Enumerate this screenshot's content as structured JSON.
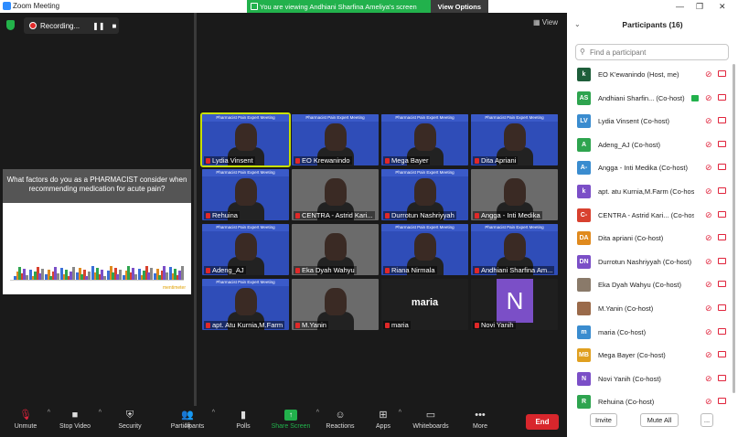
{
  "window": {
    "title": "Zoom Meeting"
  },
  "share_banner": {
    "text": "You are viewing Andhiani Sharfina Ameliya's screen",
    "view_options": "View Options"
  },
  "recording": {
    "label": "Recording..."
  },
  "view_button": "View",
  "shared_slide": {
    "question": "What factors do you as a PHARMACIST consider when recommending medication for acute pain?",
    "footer_logo": "mentimeter"
  },
  "video_tiles": [
    {
      "name": "Lydia Vinsent",
      "style": "blue",
      "banner": "Pharmacist Pain Expert Meeting",
      "active": true
    },
    {
      "name": "EO Krewanindo",
      "style": "blue",
      "banner": "Pharmacist Pain Expert Meeting"
    },
    {
      "name": "Mega Bayer",
      "style": "blue",
      "banner": "Pharmacist Pain Expert Meeting"
    },
    {
      "name": "Dita Apriani",
      "style": "blue",
      "banner": "Pharmacist Pain Expert Meeting"
    },
    {
      "name": "Rehuina",
      "style": "blue",
      "banner": "Pharmacist Pain Expert Meeting"
    },
    {
      "name": "CENTRA - Astrid Kari...",
      "style": "photo"
    },
    {
      "name": "Durrotun Nashriyyah",
      "style": "blue",
      "banner": "Pharmacist Pain Expert Meeting"
    },
    {
      "name": "Angga - Inti Medika",
      "style": "photo"
    },
    {
      "name": "Adeng_AJ",
      "style": "blue",
      "banner": "Pharmacist Pain Expert Meeting"
    },
    {
      "name": "Eka Dyah Wahyu",
      "style": "photo"
    },
    {
      "name": "Riana Nirmala",
      "style": "blue",
      "banner": "Pharmacist Pain Expert Meeting"
    },
    {
      "name": "Andhiani Sharfina Am...",
      "style": "blue",
      "banner": "Pharmacist Pain Expert Meeting"
    },
    {
      "name": "apt. Atu Kurnia,M.Farm",
      "style": "blue",
      "banner": "Pharmacist Pain Expert Meeting"
    },
    {
      "name": "M.Yanin",
      "style": "photo"
    },
    {
      "name": "maria",
      "style": "dark",
      "big": "maria"
    },
    {
      "name": "Novi Yanih",
      "style": "dark",
      "letter": "N"
    }
  ],
  "toolbar": {
    "unmute": "Unmute",
    "stop_video": "Stop Video",
    "security": "Security",
    "participants": "Participants",
    "participants_count": "16",
    "polls": "Polls",
    "share_screen": "Share Screen",
    "reactions": "Reactions",
    "apps": "Apps",
    "whiteboards": "Whiteboards",
    "more": "More",
    "end": "End"
  },
  "panel": {
    "title": "Participants (16)",
    "search_placeholder": "Find a participant",
    "participants": [
      {
        "initials": "k",
        "color": "#1e5e3a",
        "name": "EO K'ewanindo (Host, me)"
      },
      {
        "initials": "AS",
        "color": "#2ea44f",
        "name": "Andhiani Sharfin... (Co-host)",
        "sharing": true
      },
      {
        "initials": "LV",
        "color": "#3a8ccf",
        "name": "Lydia Vinsent (Co-host)"
      },
      {
        "initials": "A",
        "color": "#2ea44f",
        "name": "Adeng_AJ (Co-host)"
      },
      {
        "initials": "A-",
        "color": "#3a8ccf",
        "name": "Angga - Inti Medika (Co-host)"
      },
      {
        "initials": "k",
        "color": "#7b4fc7",
        "name": "apt. atu Kurnia,M.Farm (Co-host)"
      },
      {
        "initials": "C-",
        "color": "#d8412f",
        "name": "CENTRA - Astrid Kari... (Co-host)"
      },
      {
        "initials": "DA",
        "color": "#e08a1e",
        "name": "Dita apriani (Co-host)"
      },
      {
        "initials": "DN",
        "color": "#7b4fc7",
        "name": "Durrotun Nashriyyah (Co-host)"
      },
      {
        "initials": "",
        "color": "#8a7a6a",
        "name": "Eka Dyah Wahyu (Co-host)"
      },
      {
        "initials": "",
        "color": "#9a6a4a",
        "name": "M.Yanin (Co-host)"
      },
      {
        "initials": "m",
        "color": "#3a8ccf",
        "name": "maria (Co-host)"
      },
      {
        "initials": "MB",
        "color": "#e0a020",
        "name": "Mega Bayer (Co-host)"
      },
      {
        "initials": "N",
        "color": "#7b4fc7",
        "name": "Novi Yanih (Co-host)"
      },
      {
        "initials": "R",
        "color": "#2ea44f",
        "name": "Rehuina (Co-host)"
      }
    ],
    "invite": "Invite",
    "mute_all": "Mute All",
    "more": "..."
  }
}
